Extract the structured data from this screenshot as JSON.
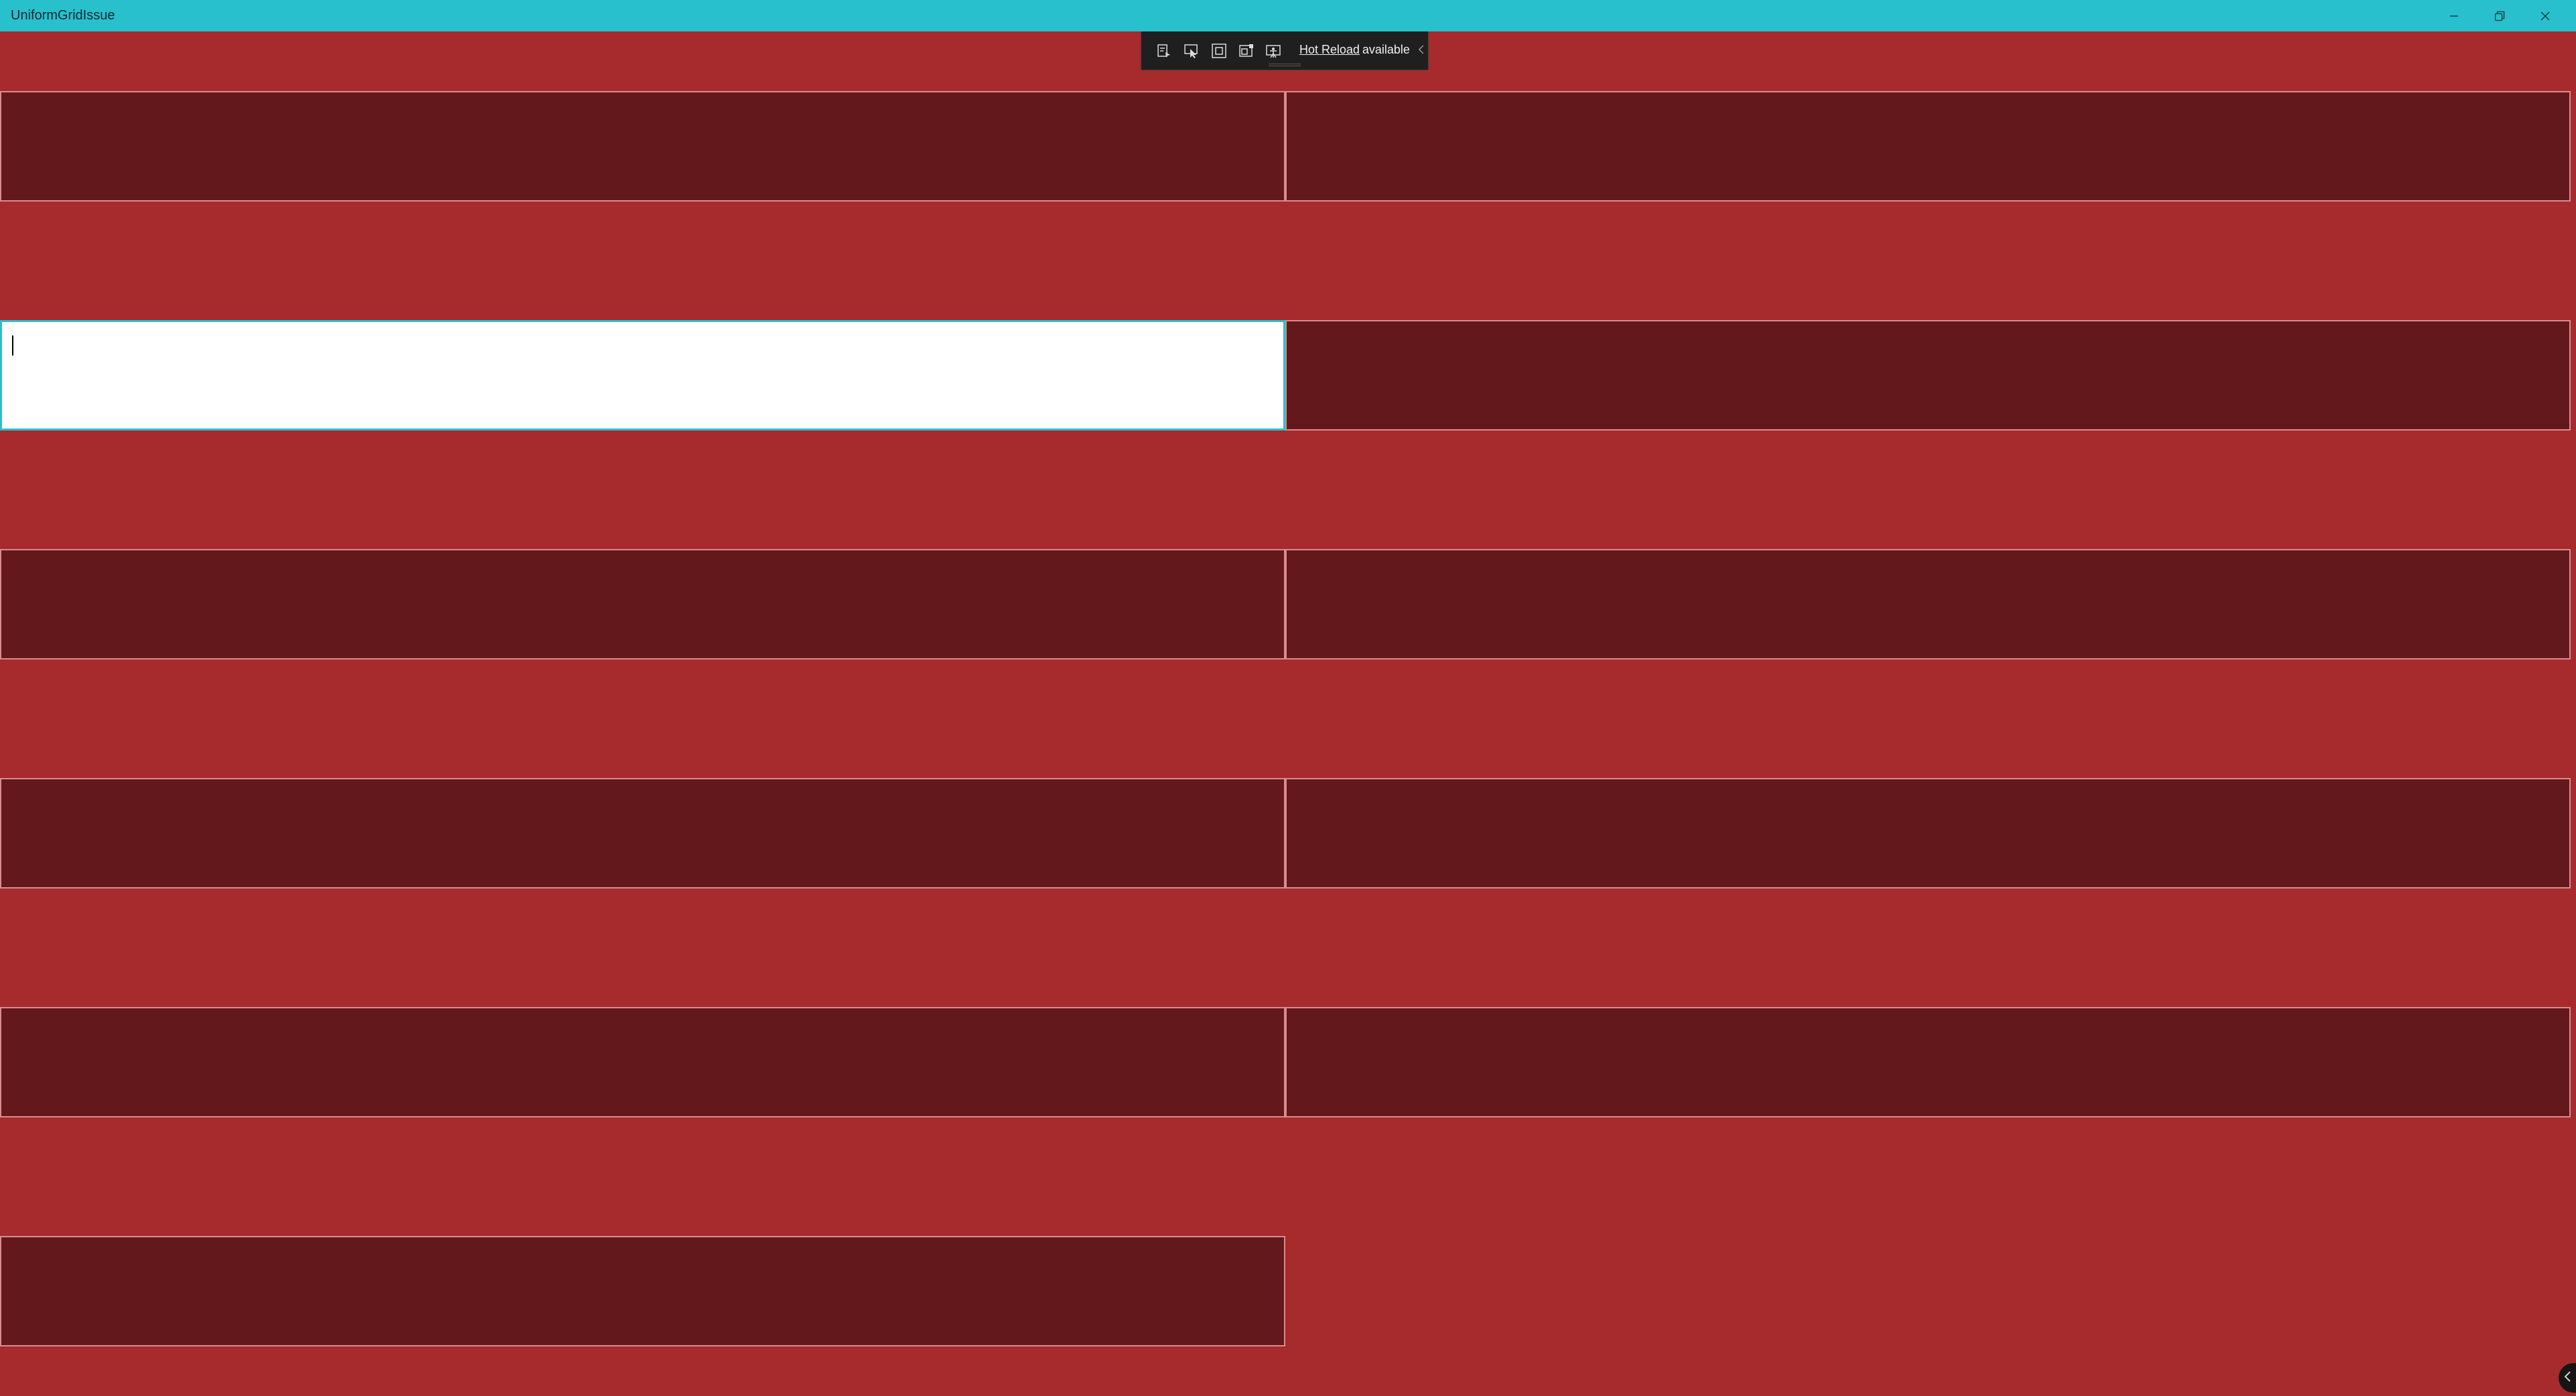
{
  "window": {
    "title": "UniformGridIssue",
    "accent_color": "#28c0cd",
    "background_color": "#a72a2d",
    "controls": {
      "minimize_icon": "minimize-icon",
      "maximize_icon": "restore-icon",
      "close_icon": "close-icon"
    }
  },
  "hot_reload_toolbar": {
    "link_label": "Hot Reload",
    "status_text": "available",
    "icons": [
      "go-to-live-visual-tree-icon",
      "select-element-icon",
      "display-layout-adorners-icon",
      "track-focused-element-icon",
      "display-accessibility-checker-icon",
      "collapse-chevron-icon"
    ]
  },
  "grid": {
    "rows": 6,
    "columns": 2,
    "text_box_count": 11,
    "focused_index": 2,
    "text_box_color": "#63181b",
    "text_box_border_color": "#d98c8c",
    "focused_background_color": "#ffffff",
    "text_boxes": [
      {
        "row": 1,
        "column": 1,
        "value": ""
      },
      {
        "row": 1,
        "column": 2,
        "value": ""
      },
      {
        "row": 2,
        "column": 1,
        "value": ""
      },
      {
        "row": 2,
        "column": 2,
        "value": ""
      },
      {
        "row": 3,
        "column": 1,
        "value": ""
      },
      {
        "row": 3,
        "column": 2,
        "value": ""
      },
      {
        "row": 4,
        "column": 1,
        "value": ""
      },
      {
        "row": 4,
        "column": 2,
        "value": ""
      },
      {
        "row": 5,
        "column": 1,
        "value": ""
      },
      {
        "row": 5,
        "column": 2,
        "value": ""
      },
      {
        "row": 6,
        "column": 1,
        "value": ""
      }
    ]
  }
}
